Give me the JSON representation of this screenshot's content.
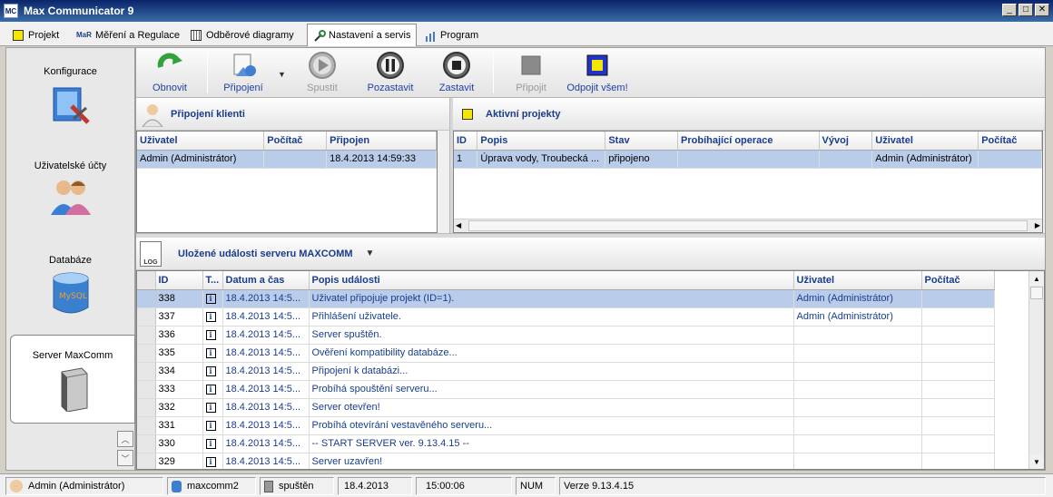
{
  "window": {
    "title": "Max Communicator 9",
    "app_icon_text": "MC"
  },
  "tabs": [
    {
      "label": "Projekt",
      "icon": "project-icon"
    },
    {
      "label": "Měření a Regulace",
      "icon": "mar-icon",
      "icon_text": "MaR"
    },
    {
      "label": "Odběrové diagramy",
      "icon": "calendar-icon"
    },
    {
      "label": "Nastavení a servis",
      "icon": "tools-icon",
      "active": true
    },
    {
      "label": "Program",
      "icon": "chart-icon"
    }
  ],
  "sidebar": {
    "items": [
      {
        "label": "Konfigurace",
        "icon": "configuration-icon"
      },
      {
        "label": "Uživatelské účty",
        "icon": "users-icon"
      },
      {
        "label": "Databáze",
        "icon": "database-icon",
        "icon_text": "MySQL"
      },
      {
        "label": "Server MaxComm",
        "icon": "server-icon",
        "active": true
      }
    ]
  },
  "toolbar": {
    "buttons": [
      {
        "label": "Obnovit",
        "icon": "refresh-icon",
        "enabled": true
      },
      {
        "label": "Připojení",
        "icon": "connection-icon",
        "enabled": true
      },
      {
        "label": "Spustit",
        "icon": "play-icon",
        "enabled": false
      },
      {
        "label": "Pozastavit",
        "icon": "pause-icon",
        "enabled": true
      },
      {
        "label": "Zastavit",
        "icon": "stop-icon",
        "enabled": true
      },
      {
        "label": "Připojit",
        "icon": "connect-icon",
        "enabled": false
      },
      {
        "label": "Odpojit všem!",
        "icon": "disconnect-all-icon",
        "enabled": true
      }
    ]
  },
  "clients_panel": {
    "title": "Připojení klienti",
    "columns": [
      "Uživatel",
      "Počítač",
      "Připojen"
    ],
    "rows": [
      [
        "Admin (Administrátor)",
        "",
        "18.4.2013 14:59:33"
      ]
    ]
  },
  "projects_panel": {
    "title": "Aktivní projekty",
    "columns": [
      "ID",
      "Popis",
      "Stav",
      "Probíhající operace",
      "Vývoj",
      "Uživatel",
      "Počítač"
    ],
    "rows": [
      [
        "1",
        "Úprava vody, Troubecká ...",
        "připojeno",
        "",
        "",
        "Admin (Administrátor)",
        ""
      ]
    ]
  },
  "events_panel": {
    "title": "Uložené události serveru MAXCOMM",
    "log_icon_text": "LOG",
    "columns": [
      "ID",
      "T...",
      "Datum a čas",
      "Popis události",
      "Uživatel",
      "Počítač"
    ],
    "rows": [
      [
        "338",
        "i",
        "18.4.2013 14:5...",
        "Uživatel připojuje projekt (ID=1).",
        "Admin (Administrátor)",
        ""
      ],
      [
        "337",
        "i",
        "18.4.2013 14:5...",
        "Přihlášení uživatele.",
        "Admin (Administrátor)",
        ""
      ],
      [
        "336",
        "i",
        "18.4.2013 14:5...",
        "Server spuštěn.",
        "",
        ""
      ],
      [
        "335",
        "i",
        "18.4.2013 14:5...",
        "Ověření kompatibility databáze...",
        "",
        ""
      ],
      [
        "334",
        "i",
        "18.4.2013 14:5...",
        "Připojení k databázi...",
        "",
        ""
      ],
      [
        "333",
        "i",
        "18.4.2013 14:5...",
        "Probíhá spouštění serveru...",
        "",
        ""
      ],
      [
        "332",
        "i",
        "18.4.2013 14:5...",
        "Server otevřen!",
        "",
        ""
      ],
      [
        "331",
        "i",
        "18.4.2013 14:5...",
        "Probíhá otevírání vestavěného serveru...",
        "",
        ""
      ],
      [
        "330",
        "i",
        "18.4.2013 14:5...",
        "-- START SERVER ver. 9.13.4.15 --",
        "",
        ""
      ],
      [
        "329",
        "i",
        "18.4.2013 14:5...",
        "Server uzavřen!",
        "",
        ""
      ]
    ]
  },
  "statusbar": {
    "user": "Admin (Administrátor)",
    "database": "maxcomm2",
    "server_state": "spuštěn",
    "date": "18.4.2013",
    "time": "15:00:06",
    "num": "NUM",
    "version": "Verze 9.13.4.15"
  }
}
